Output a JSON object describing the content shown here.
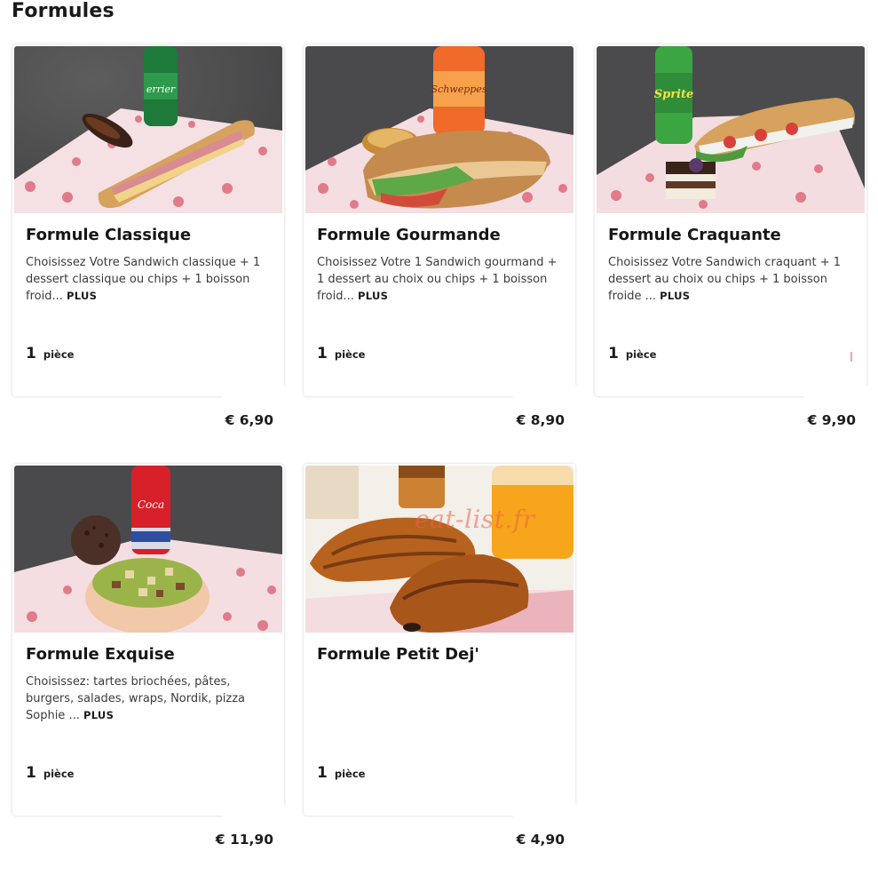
{
  "section": {
    "title": "Formules"
  },
  "products": [
    {
      "name": "Formule Classique",
      "description": "Choisissez Votre Sandwich classique + 1 dessert classique ou chips + 1 boisson froid...",
      "more_label": "PLUS",
      "quantity": "1",
      "unit": "pièce",
      "price": "€ 6,90",
      "image": "sandwich-perrier-eclair"
    },
    {
      "name": "Formule Gourmande",
      "description": "Choisissez Votre 1 Sandwich gourmand + 1 dessert au choix ou chips + 1 boisson froid...",
      "more_label": "PLUS",
      "quantity": "1",
      "unit": "pièce",
      "price": "€ 8,90",
      "image": "sandwich-schweppes-tartlet"
    },
    {
      "name": "Formule Craquante",
      "description": "Choisissez Votre Sandwich craquant + 1 dessert au choix ou chips + 1 boisson froide ...",
      "more_label": "PLUS",
      "quantity": "1",
      "unit": "pièce",
      "price": "€ 9,90",
      "image": "sandwich-sprite-cake"
    },
    {
      "name": "Formule Exquise",
      "description": "Choisissez: tartes briochées, pâtes, burgers, salades, wraps, Nordik, pizza Sophie ...",
      "more_label": "PLUS",
      "quantity": "1",
      "unit": "pièce",
      "price": "€ 11,90",
      "image": "salad-cocacola-cookie"
    },
    {
      "name": "Formule Petit Dej'",
      "description": "",
      "more_label": "",
      "quantity": "1",
      "unit": "pièce",
      "price": "€ 4,90",
      "image": "croissant-orange-juice"
    }
  ],
  "watermark": "eat-list.fr",
  "colors": {
    "table": "#4a4a4b",
    "paper": "#f4dfe2",
    "paper_dot": "#e07b8a",
    "bread": "#d9a35e",
    "perrier": "#1d7a3a",
    "schweppes": "#f06a2a",
    "sprite": "#3aa541",
    "cola": "#d8202a"
  }
}
